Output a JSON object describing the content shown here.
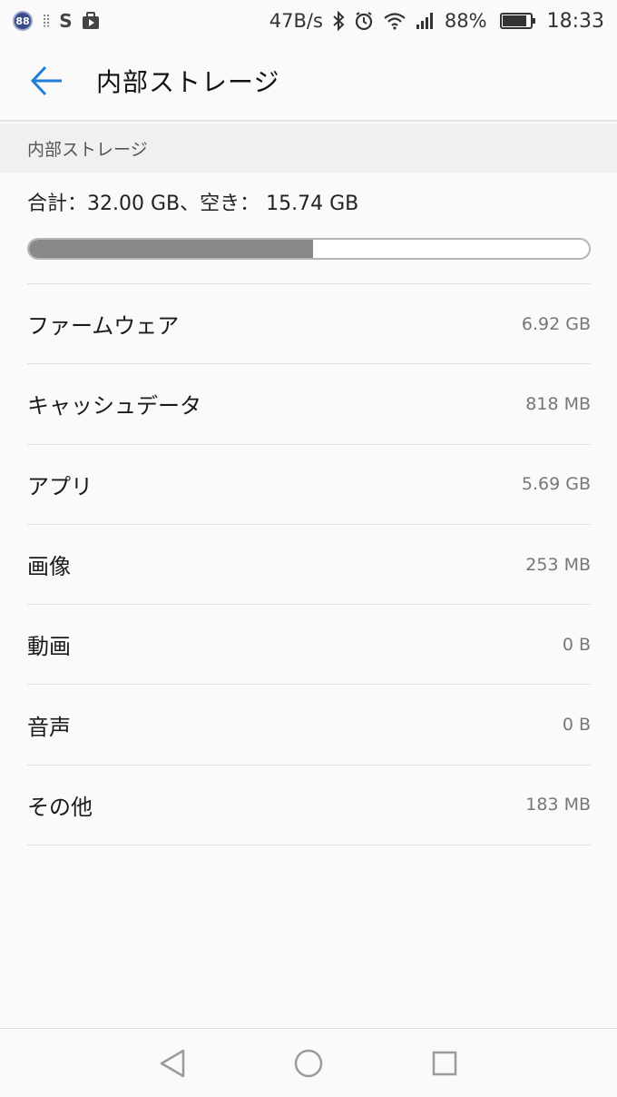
{
  "status_bar": {
    "badge": "88",
    "net_speed": "47B/s",
    "battery_percent": "88%",
    "battery_level": 0.88,
    "time": "18:33",
    "icons": [
      "notification-badge-icon",
      "usb-icon",
      "s-app-icon",
      "video-bag-icon",
      "bluetooth-icon",
      "alarm-icon",
      "wifi-icon",
      "signal-icon",
      "battery-icon"
    ]
  },
  "toolbar": {
    "title": "内部ストレージ",
    "back_icon": "back-arrow-icon"
  },
  "section": {
    "header": "内部ストレージ"
  },
  "summary": {
    "text": "合計：32.00 GB、空き： 15.74 GB",
    "used_fraction": 0.508
  },
  "items": [
    {
      "label": "ファームウェア",
      "value": "6.92 GB"
    },
    {
      "label": "キャッシュデータ",
      "value": "818 MB"
    },
    {
      "label": "アプリ",
      "value": "5.69 GB"
    },
    {
      "label": "画像",
      "value": "253 MB"
    },
    {
      "label": "動画",
      "value": "0 B"
    },
    {
      "label": "音声",
      "value": "0 B"
    },
    {
      "label": "その他",
      "value": "183 MB"
    }
  ],
  "colors": {
    "accent": "#1e7fd8",
    "bar_fill": "#888888",
    "background": "#fafafa"
  }
}
